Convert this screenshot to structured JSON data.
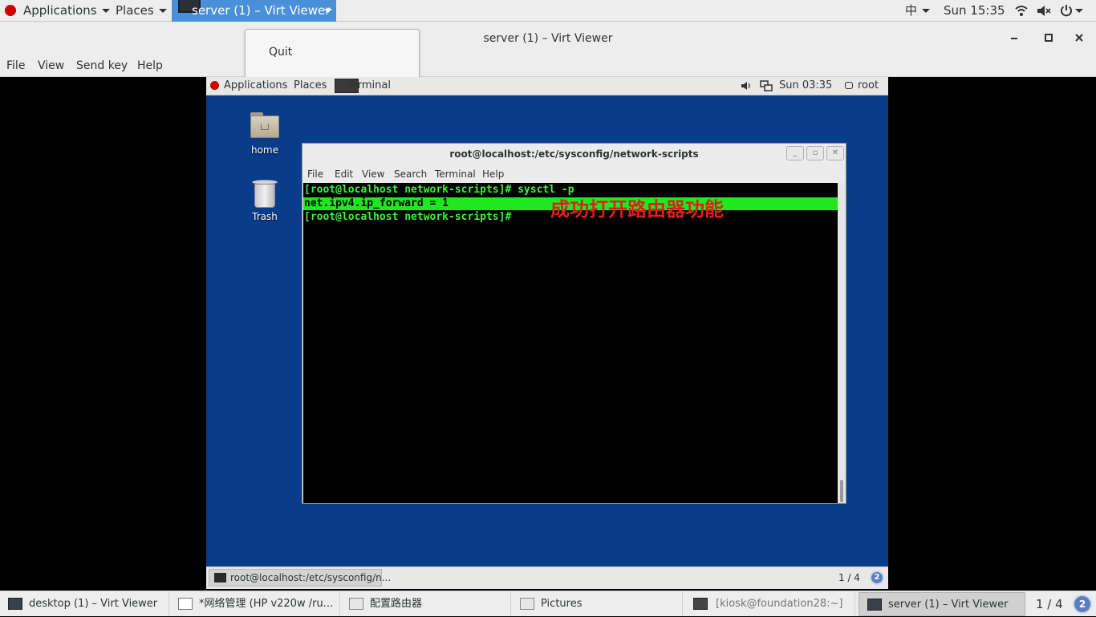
{
  "host_panel": {
    "applications_label": "Applications",
    "places_label": "Places",
    "active_window_label": "server (1) – Virt Viewer",
    "input_method": "中",
    "clock": "Sun 15:35"
  },
  "virt_viewer": {
    "title": "server (1) – Virt Viewer",
    "menu": [
      "File",
      "View",
      "Send key",
      "Help"
    ],
    "popup_item": "Quit"
  },
  "guest": {
    "panel": {
      "applications_label": "Applications",
      "places_label": "Places",
      "active_task": "Terminal",
      "clock": "Sun 03:35",
      "user": "root"
    },
    "desktop_icons": [
      "home",
      "Trash"
    ],
    "terminal": {
      "title": "root@localhost:/etc/sysconfig/network-scripts",
      "menu": [
        "File",
        "Edit",
        "View",
        "Search",
        "Terminal",
        "Help"
      ],
      "lines": [
        "[root@localhost network-scripts]# sysctl -p",
        "net.ipv4.ip_forward = 1",
        "[root@localhost network-scripts]# "
      ],
      "annotation": "成功打开路由器功能"
    },
    "taskbar": {
      "task": "root@localhost:/etc/sysconfig/n...",
      "workspace": "1 / 4",
      "badge": "2"
    }
  },
  "host_taskbar": {
    "items": [
      "desktop (1) – Virt Viewer",
      "*网络管理 (HP v220w /ru...",
      "配置路由器",
      "Pictures",
      "[kiosk@foundation28:~]",
      "server (1) – Virt Viewer"
    ],
    "workspace": "1 / 4",
    "badge": "2"
  },
  "colors": {
    "guest_desktop": "#0a3c8c",
    "terminal_green": "#3ff33f",
    "highlight": "#1fe81f",
    "annotation_red": "#e11d1d",
    "selection_blue": "#4a90d9"
  }
}
